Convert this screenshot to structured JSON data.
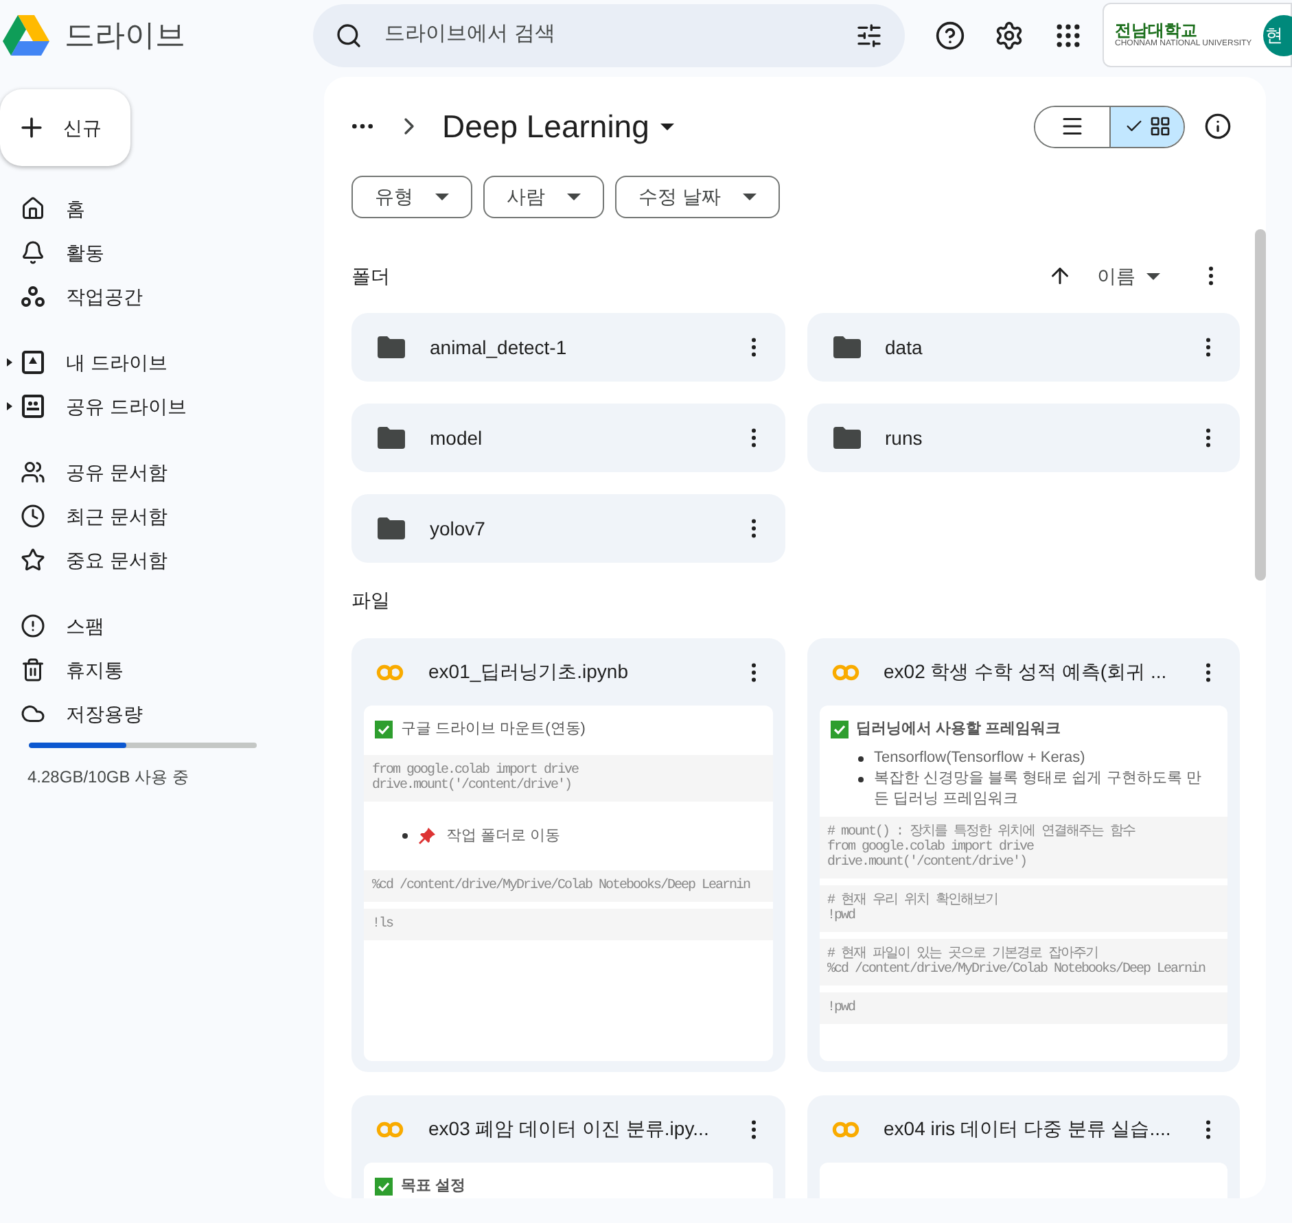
{
  "app": {
    "title": "드라이브"
  },
  "search": {
    "placeholder": "드라이브에서 검색"
  },
  "account": {
    "org_name": "전남대학교",
    "org_subtitle": "CHONNAM NATIONAL UNIVERSITY",
    "avatar_letter": "현"
  },
  "new_button": {
    "label": "신규"
  },
  "sidebar": {
    "groups": [
      [
        {
          "kind": "home",
          "label": "홈",
          "expandable": false
        },
        {
          "kind": "activity",
          "label": "활동",
          "expandable": false
        },
        {
          "kind": "workspace",
          "label": "작업공간",
          "expandable": false
        }
      ],
      [
        {
          "kind": "mydrive",
          "label": "내 드라이브",
          "expandable": true
        },
        {
          "kind": "shareddrive",
          "label": "공유 드라이브",
          "expandable": true
        }
      ],
      [
        {
          "kind": "shared",
          "label": "공유 문서함",
          "expandable": false
        },
        {
          "kind": "recent",
          "label": "최근 문서함",
          "expandable": false
        },
        {
          "kind": "starred",
          "label": "중요 문서함",
          "expandable": false
        }
      ],
      [
        {
          "kind": "spam",
          "label": "스팸",
          "expandable": false
        },
        {
          "kind": "trash",
          "label": "휴지통",
          "expandable": false
        },
        {
          "kind": "storage",
          "label": "저장용량",
          "expandable": false
        }
      ]
    ]
  },
  "storage": {
    "level": 0.43,
    "text": "4.28GB/10GB 사용 중"
  },
  "breadcrumb": {
    "title": "Deep Learning"
  },
  "view_toggle": [
    {
      "kind": "list",
      "selected": false
    },
    {
      "kind": "grid",
      "selected": true
    }
  ],
  "filters": [
    {
      "label": "유형"
    },
    {
      "label": "사람"
    },
    {
      "label": "수정 날짜"
    }
  ],
  "folders_heading": "폴더",
  "sort": {
    "label": "이름"
  },
  "folders": [
    {
      "name": "animal_detect-1"
    },
    {
      "name": "data"
    },
    {
      "name": "model"
    },
    {
      "name": "runs"
    },
    {
      "name": "yolov7"
    }
  ],
  "files_heading": "파일",
  "files": [
    {
      "name": "ex01_딥러닝기초.ipynb",
      "thumbnail": [
        {
          "kind": "heading",
          "bold": false,
          "text": "구글 드라이브 마운트(연동)"
        },
        {
          "kind": "code",
          "lines": [
            "from google.colab import drive",
            "drive.mount('/content/drive')"
          ]
        },
        {
          "kind": "pin_bullet",
          "text": "작업 폴더로 이동"
        },
        {
          "kind": "code",
          "lines": [
            "%cd /content/drive/MyDrive/Colab Notebooks/Deep Learnin"
          ]
        },
        {
          "kind": "code",
          "lines": [
            "!ls"
          ]
        }
      ]
    },
    {
      "name": "ex02 학생 수학 성적 예측(회귀 ...",
      "thumbnail": [
        {
          "kind": "heading",
          "bold": true,
          "text": "딥러닝에서 사용할 프레임워크"
        },
        {
          "kind": "bullet",
          "text": "Tensorflow(Tensorflow + Keras)"
        },
        {
          "kind": "bullet",
          "text": "복잡한 신경망을 블록 형태로 쉽게 구현하도록 만든 딥러닝 프레임워크"
        },
        {
          "kind": "code",
          "lines": [
            "# mount() : 장치를 특정한 위치에 연결해주는 함수",
            "from google.colab import drive",
            "drive.mount('/content/drive')"
          ]
        },
        {
          "kind": "code",
          "lines": [
            "# 현재 우리 위치 확인해보기",
            "!pwd"
          ]
        },
        {
          "kind": "code",
          "lines": [
            "# 현재 파일이 있는 곳으로 기본경로 잡아주기",
            "%cd /content/drive/MyDrive/Colab Notebooks/Deep Learnin"
          ]
        },
        {
          "kind": "code",
          "lines": [
            "!pwd"
          ]
        }
      ]
    },
    {
      "name": "ex03 폐암 데이터 이진 분류.ipy...",
      "thumbnail": [
        {
          "kind": "heading",
          "bold": true,
          "text": "목표 설정"
        }
      ]
    },
    {
      "name": "ex04 iris 데이터 다중 분류 실습...."
    }
  ]
}
